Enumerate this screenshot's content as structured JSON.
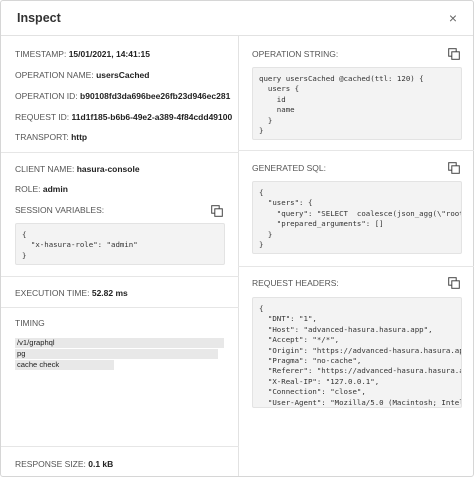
{
  "modal": {
    "title": "Inspect",
    "close_label": "×"
  },
  "left": {
    "timestamp": {
      "label": "TIMESTAMP:",
      "value": "15/01/2021, 14:41:15"
    },
    "operation_name": {
      "label": "OPERATION NAME:",
      "value": "usersCached"
    },
    "operation_id": {
      "label": "OPERATION ID:",
      "value": "b90108fd3da696bee26fb23d946ec281"
    },
    "request_id": {
      "label": "REQUEST ID:",
      "value": "11d1f185-b6b6-49e2-a389-4f84cdd49100"
    },
    "transport": {
      "label": "TRANSPORT:",
      "value": "http"
    },
    "client_name": {
      "label": "CLIENT NAME:",
      "value": "hasura-console"
    },
    "role": {
      "label": "ROLE:",
      "value": "admin"
    },
    "session_variables": {
      "label": "SESSION VARIABLES:",
      "code": "{\n  \"x-hasura-role\": \"admin\"\n}"
    },
    "execution_time": {
      "label": "EXECUTION TIME:",
      "value": "52.82 ms"
    },
    "timing": {
      "label": "TIMING",
      "bars": [
        {
          "name": "/v1/graphql",
          "fraction": 1.0
        },
        {
          "name": "pg",
          "fraction": 0.97
        },
        {
          "name": "cache check",
          "fraction": 0.47
        }
      ]
    },
    "response_size": {
      "label": "RESPONSE SIZE:",
      "value": "0.1 kB"
    }
  },
  "right": {
    "operation_string": {
      "label": "OPERATION STRING:",
      "code": "query usersCached @cached(ttl: 120) {\n  users {\n    id\n    name\n  }\n}"
    },
    "generated_sql": {
      "label": "GENERATED SQL:",
      "code": "{\n  \"users\": {\n    \"query\": \"SELECT  coalesce(json_agg(\\\"root\\\"\n    \"prepared_arguments\": []\n  }\n}"
    },
    "request_headers": {
      "label": "REQUEST HEADERS:",
      "code": "{\n  \"DNT\": \"1\",\n  \"Host\": \"advanced-hasura.hasura.app\",\n  \"Accept\": \"*/*\",\n  \"Origin\": \"https://advanced-hasura.hasura.app\n  \"Pragma\": \"no-cache\",\n  \"Referer\": \"https://advanced-hasura.hasura.app\n  \"X-Real-IP\": \"127.0.0.1\",\n  \"Connection\": \"close\",\n  \"User-Agent\": \"Mozilla/5.0 (Macintosh; Intel\n  \"content-type\": \"application/json\","
    }
  },
  "icons": {
    "copy": "copy-icon",
    "close": "close-icon"
  }
}
